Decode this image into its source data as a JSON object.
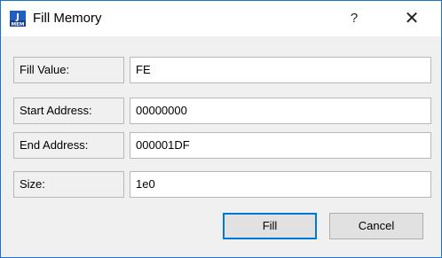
{
  "window": {
    "title": "Fill Memory",
    "help_label": "?",
    "close_label": "✕",
    "accent_color": "#1a73c8",
    "app_icon": "j-mem-icon"
  },
  "fields": [
    {
      "label": "Fill Value:",
      "value": "FE"
    },
    {
      "label": "Start Address:",
      "value": "00000000"
    },
    {
      "label": "End Address:",
      "value": "000001DF"
    },
    {
      "label": "Size:",
      "value": "1e0"
    }
  ],
  "buttons": {
    "fill_label": "Fill",
    "cancel_label": "Cancel"
  }
}
